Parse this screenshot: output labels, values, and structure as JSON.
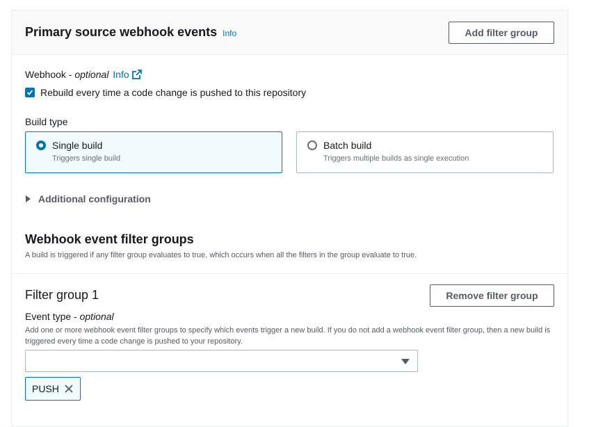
{
  "header": {
    "title": "Primary source webhook events",
    "info": "Info",
    "add_filter_group_label": "Add filter group"
  },
  "webhook": {
    "label": "Webhook",
    "optional": "optional",
    "separator": " - ",
    "info": "Info",
    "checkbox_label": "Rebuild every time a code change is pushed to this repository",
    "checked": true
  },
  "build_type": {
    "label": "Build type",
    "options": [
      {
        "title": "Single build",
        "description": "Triggers single build",
        "selected": true
      },
      {
        "title": "Batch build",
        "description": "Triggers multiple builds as single execution",
        "selected": false
      }
    ]
  },
  "additional_configuration": {
    "label": "Additional configuration"
  },
  "filter_groups_section": {
    "title": "Webhook event filter groups",
    "description": "A build is triggered if any filter group evaluates to true, which occurs when all the filters in the group evaluate to true."
  },
  "filter_group": {
    "title": "Filter group 1",
    "remove_label": "Remove filter group",
    "event_type": {
      "label": "Event type",
      "optional": "optional",
      "separator": " - ",
      "description": "Add one or more webhook event filter groups to specify which events trigger a new build. If you do not add a webhook event filter group, then a new build is triggered every time a code change is pushed to your repository.",
      "select_value": "",
      "tokens": [
        "PUSH"
      ]
    }
  },
  "colors": {
    "accent": "#0073bb",
    "text": "#16191f",
    "muted": "#545b64",
    "border": "#aab7b8"
  }
}
